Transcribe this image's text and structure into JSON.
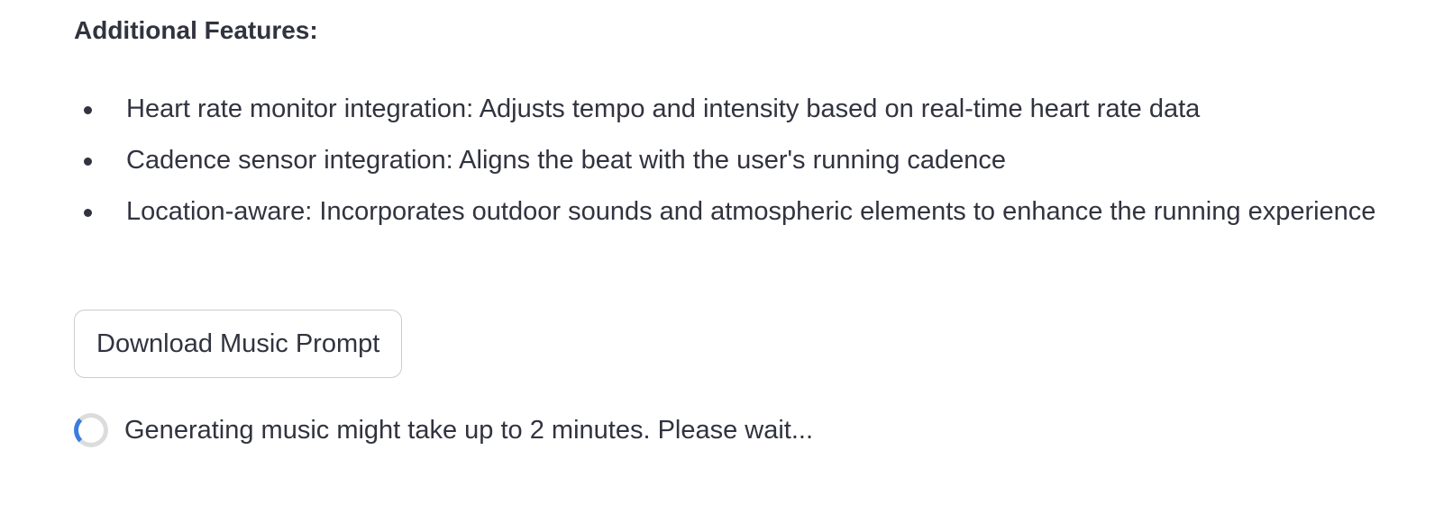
{
  "section": {
    "heading": "Additional Features:"
  },
  "features": [
    {
      "text": "Heart rate monitor integration: Adjusts tempo and intensity based on real-time heart rate data"
    },
    {
      "text": "Cadence sensor integration: Aligns the beat with the user's running cadence"
    },
    {
      "text": "Location-aware: Incorporates outdoor sounds and atmospheric elements to enhance the running experience"
    }
  ],
  "download_button": {
    "label": "Download Music Prompt"
  },
  "status": {
    "message": "Generating music might take up to 2 minutes. Please wait...",
    "spinner_icon": "loading-spinner-icon"
  },
  "colors": {
    "text": "#31333f",
    "spinner_accent": "#3b7ddd",
    "spinner_track": "#dcdcdc",
    "button_border": "rgba(49, 51, 63, 0.25)"
  }
}
